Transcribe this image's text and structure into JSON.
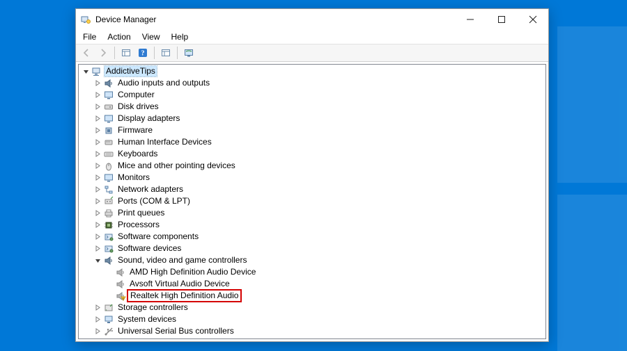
{
  "window": {
    "title": "Device Manager"
  },
  "menubar": {
    "items": [
      {
        "label": "File"
      },
      {
        "label": "Action"
      },
      {
        "label": "View"
      },
      {
        "label": "Help"
      }
    ]
  },
  "toolbar": {
    "buttons": [
      {
        "name": "back",
        "icon": "arrow-left",
        "disabled": true
      },
      {
        "name": "forward",
        "icon": "arrow-right",
        "disabled": true
      },
      {
        "sep": true
      },
      {
        "name": "show-hidden",
        "icon": "panel"
      },
      {
        "name": "help",
        "icon": "help-blue"
      },
      {
        "sep": true
      },
      {
        "name": "properties",
        "icon": "panel"
      },
      {
        "sep": true
      },
      {
        "name": "scan",
        "icon": "scan-monitor"
      }
    ]
  },
  "tree": {
    "root": {
      "label": "AddictiveTips",
      "icon": "computer",
      "expanded": true,
      "selected": true,
      "children": [
        {
          "label": "Audio inputs and outputs",
          "icon": "speaker",
          "expandable": true
        },
        {
          "label": "Computer",
          "icon": "monitor",
          "expandable": true
        },
        {
          "label": "Disk drives",
          "icon": "disk",
          "expandable": true
        },
        {
          "label": "Display adapters",
          "icon": "monitor",
          "expandable": true
        },
        {
          "label": "Firmware",
          "icon": "chip",
          "expandable": true
        },
        {
          "label": "Human Interface Devices",
          "icon": "hid",
          "expandable": true
        },
        {
          "label": "Keyboards",
          "icon": "keyboard",
          "expandable": true
        },
        {
          "label": "Mice and other pointing devices",
          "icon": "mouse",
          "expandable": true
        },
        {
          "label": "Monitors",
          "icon": "monitor",
          "expandable": true
        },
        {
          "label": "Network adapters",
          "icon": "network",
          "expandable": true
        },
        {
          "label": "Ports (COM & LPT)",
          "icon": "port",
          "expandable": true
        },
        {
          "label": "Print queues",
          "icon": "printer",
          "expandable": true
        },
        {
          "label": "Processors",
          "icon": "cpu",
          "expandable": true
        },
        {
          "label": "Software components",
          "icon": "component",
          "expandable": true
        },
        {
          "label": "Software devices",
          "icon": "component",
          "expandable": true
        },
        {
          "label": "Sound, video and game controllers",
          "icon": "speaker",
          "expanded": true,
          "children": [
            {
              "label": "AMD High Definition Audio Device",
              "icon": "speaker-grey"
            },
            {
              "label": "Avsoft Virtual Audio Device",
              "icon": "speaker-grey"
            },
            {
              "label": "Realtek High Definition Audio",
              "icon": "speaker-warn",
              "highlighted": true
            }
          ]
        },
        {
          "label": "Storage controllers",
          "icon": "storage",
          "expandable": true
        },
        {
          "label": "System devices",
          "icon": "system",
          "expandable": true
        },
        {
          "label": "Universal Serial Bus controllers",
          "icon": "usb",
          "expandable": true
        }
      ]
    }
  }
}
